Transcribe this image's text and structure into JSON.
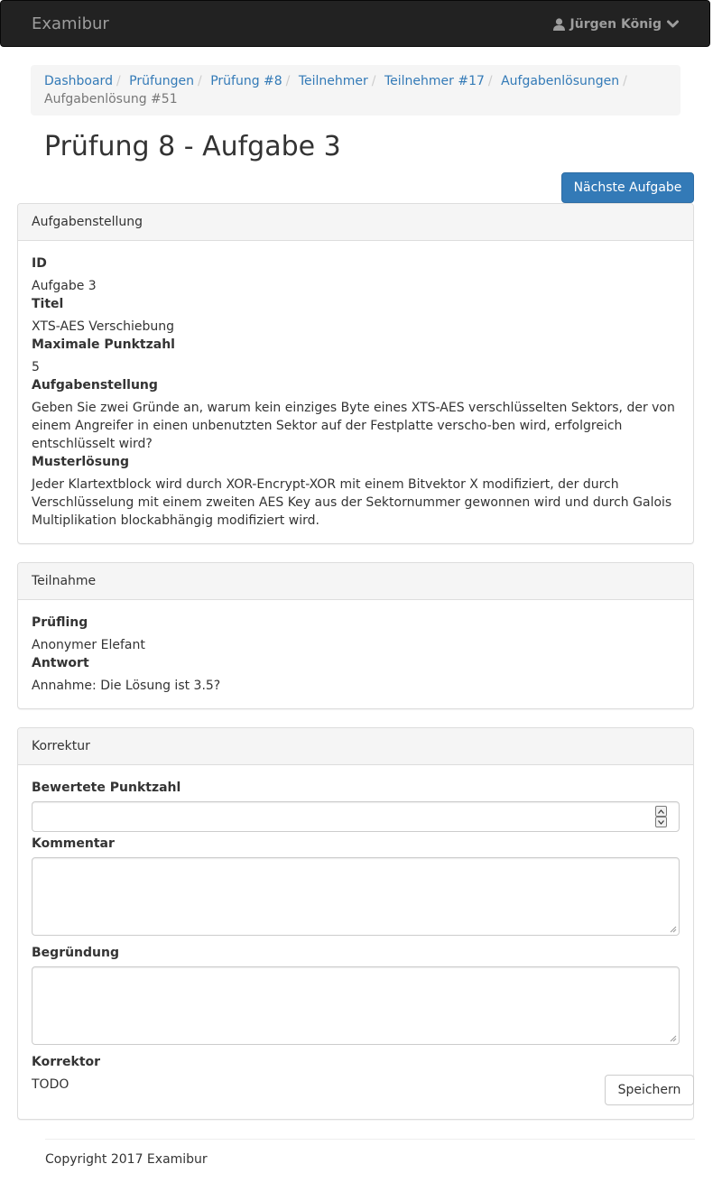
{
  "navbar": {
    "brand": "Examibur",
    "user_name": "Jürgen König"
  },
  "breadcrumb": [
    {
      "label": "Dashboard"
    },
    {
      "label": "Prüfungen"
    },
    {
      "label": "Prüfung #8"
    },
    {
      "label": "Teilnehmer"
    },
    {
      "label": "Teilnehmer #17"
    },
    {
      "label": "Aufgabenlösungen"
    },
    {
      "label": "Aufgabenlösung #51"
    }
  ],
  "page": {
    "title": "Prüfung 8 - Aufgabe 3",
    "next_button": "Nächste Aufgabe"
  },
  "task_panel": {
    "heading": "Aufgabenstellung",
    "id_label": "ID",
    "id_value": "Aufgabe 3",
    "title_label": "Titel",
    "title_value": "XTS-AES Verschiebung",
    "max_points_label": "Maximale Punktzahl",
    "max_points_value": "5",
    "task_label": "Aufgabenstellung",
    "task_value": "Geben Sie zwei Gründe an, warum kein einziges Byte eines XTS-AES verschlüsselten Sektors, der von einem Angreifer in einen unbenutzten Sektor auf der Festplatte verscho-ben wird, erfolgreich entschlüsselt wird?",
    "solution_label": "Musterlösung",
    "solution_value": "Jeder Klartextblock wird durch XOR-Encrypt-XOR mit einem Bitvektor X modifiziert, der durch Verschlüsselung mit einem zweiten AES Key aus der Sektornummer gewonnen wird und durch Galois Multiplikation blockabhängig modifiziert wird."
  },
  "participation_panel": {
    "heading": "Teilnahme",
    "examinee_label": "Prüfling",
    "examinee_value": "Anonymer Elefant",
    "answer_label": "Antwort",
    "answer_value": "Annahme: Die Lösung ist 3.5?"
  },
  "correction_panel": {
    "heading": "Korrektur",
    "points_label": "Bewertete Punktzahl",
    "points_value": "",
    "comment_label": "Kommentar",
    "comment_value": "",
    "reason_label": "Begründung",
    "reason_value": "",
    "corrector_label": "Korrektor",
    "corrector_value": "TODO",
    "save_button": "Speichern"
  },
  "footer": {
    "copyright": "Copyright 2017 Examibur"
  },
  "colors": {
    "navbar_bg": "#222222",
    "navbar_text": "#9d9d9d",
    "link": "#337ab7",
    "primary_button": "#337ab7",
    "panel_heading_bg": "#f5f5f5"
  },
  "icons": {
    "user": "user-icon",
    "dropdown": "chevron-down-icon"
  }
}
